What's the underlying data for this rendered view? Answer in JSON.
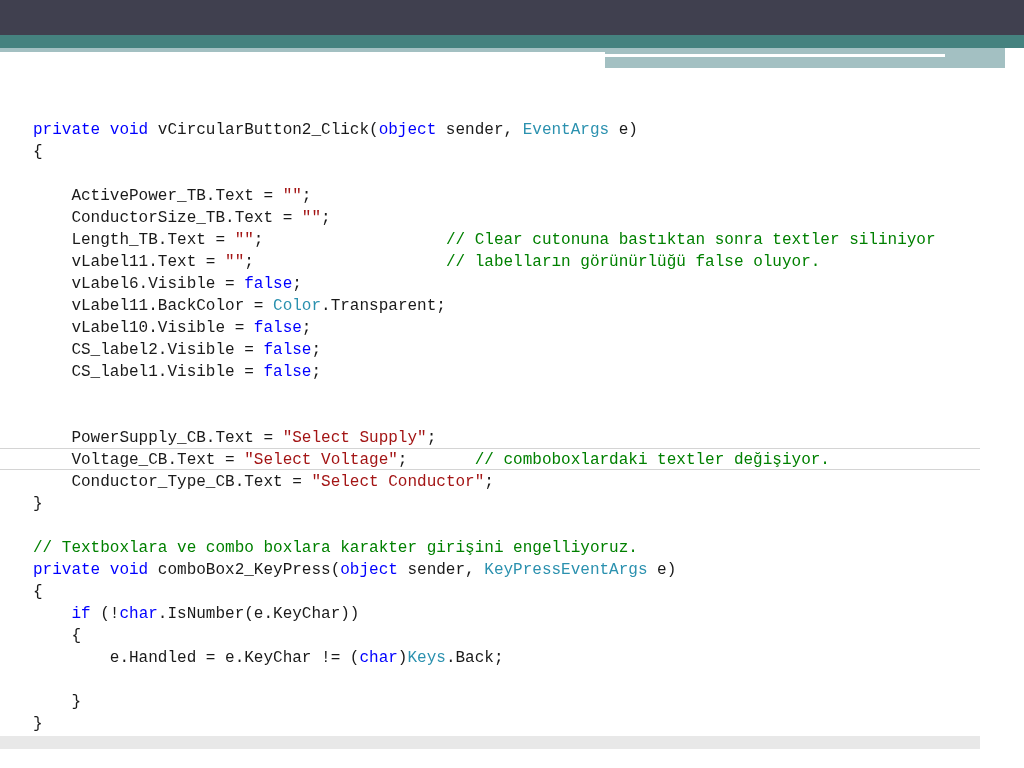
{
  "code": {
    "lines": [
      {
        "current": false,
        "tokens": [
          {
            "kind": "keyword",
            "text": "private void"
          },
          {
            "kind": "plain",
            "text": " vCircularButton2_Click("
          },
          {
            "kind": "keyword",
            "text": "object"
          },
          {
            "kind": "plain",
            "text": " sender, "
          },
          {
            "kind": "type",
            "text": "EventArgs"
          },
          {
            "kind": "plain",
            "text": " e)"
          }
        ]
      },
      {
        "current": false,
        "tokens": [
          {
            "kind": "plain",
            "text": "{"
          }
        ]
      },
      {
        "current": false
      },
      {
        "current": false,
        "tokens": [
          {
            "kind": "plain",
            "text": "    ActivePower_TB.Text = "
          },
          {
            "kind": "string",
            "text": "\"\""
          },
          {
            "kind": "plain",
            "text": ";"
          }
        ]
      },
      {
        "current": false,
        "tokens": [
          {
            "kind": "plain",
            "text": "    ConductorSize_TB.Text = "
          },
          {
            "kind": "string",
            "text": "\"\""
          },
          {
            "kind": "plain",
            "text": ";"
          }
        ]
      },
      {
        "current": false,
        "tokens": [
          {
            "kind": "plain",
            "text": "    Length_TB.Text = "
          },
          {
            "kind": "string",
            "text": "\"\""
          },
          {
            "kind": "plain",
            "text": ";                   "
          },
          {
            "kind": "comment",
            "text": "// Clear cutonuna bastıktan sonra textler siliniyor"
          }
        ]
      },
      {
        "current": false,
        "tokens": [
          {
            "kind": "plain",
            "text": "    vLabel11.Text = "
          },
          {
            "kind": "string",
            "text": "\"\""
          },
          {
            "kind": "plain",
            "text": ";                    "
          },
          {
            "kind": "comment",
            "text": "// labelların görünürlüğü false oluyor."
          }
        ]
      },
      {
        "current": false,
        "tokens": [
          {
            "kind": "plain",
            "text": "    vLabel6.Visible = "
          },
          {
            "kind": "keyword",
            "text": "false"
          },
          {
            "kind": "plain",
            "text": ";"
          }
        ]
      },
      {
        "current": false,
        "tokens": [
          {
            "kind": "plain",
            "text": "    vLabel11.BackColor = "
          },
          {
            "kind": "type",
            "text": "Color"
          },
          {
            "kind": "plain",
            "text": ".Transparent;"
          }
        ]
      },
      {
        "current": false,
        "tokens": [
          {
            "kind": "plain",
            "text": "    vLabel10.Visible = "
          },
          {
            "kind": "keyword",
            "text": "false"
          },
          {
            "kind": "plain",
            "text": ";"
          }
        ]
      },
      {
        "current": false,
        "tokens": [
          {
            "kind": "plain",
            "text": "    CS_label2.Visible = "
          },
          {
            "kind": "keyword",
            "text": "false"
          },
          {
            "kind": "plain",
            "text": ";"
          }
        ]
      },
      {
        "current": false,
        "tokens": [
          {
            "kind": "plain",
            "text": "    CS_label1.Visible = "
          },
          {
            "kind": "keyword",
            "text": "false"
          },
          {
            "kind": "plain",
            "text": ";"
          }
        ]
      },
      {
        "current": false
      },
      {
        "current": false
      },
      {
        "current": false,
        "tokens": [
          {
            "kind": "plain",
            "text": "    PowerSupply_CB.Text = "
          },
          {
            "kind": "string",
            "text": "\"Select Supply\""
          },
          {
            "kind": "plain",
            "text": ";"
          }
        ]
      },
      {
        "current": true,
        "tokens": [
          {
            "kind": "plain",
            "text": "    Voltage_CB.Text = "
          },
          {
            "kind": "string",
            "text": "\"Select Voltage\""
          },
          {
            "kind": "plain",
            "text": ";       "
          },
          {
            "kind": "comment",
            "text": "// comboboxlardaki textler değişiyor."
          }
        ]
      },
      {
        "current": false,
        "tokens": [
          {
            "kind": "plain",
            "text": "    Conductor_Type_CB.Text = "
          },
          {
            "kind": "string",
            "text": "\"Select Conductor\""
          },
          {
            "kind": "plain",
            "text": ";"
          }
        ]
      },
      {
        "current": false,
        "tokens": [
          {
            "kind": "plain",
            "text": "}"
          }
        ]
      },
      {
        "current": false
      },
      {
        "current": false,
        "tokens": [
          {
            "kind": "comment",
            "text": "// Textboxlara ve combo boxlara karakter girişini engelliyoruz."
          }
        ]
      },
      {
        "current": false,
        "tokens": [
          {
            "kind": "keyword",
            "text": "private void"
          },
          {
            "kind": "plain",
            "text": " comboBox2_KeyPress("
          },
          {
            "kind": "keyword",
            "text": "object"
          },
          {
            "kind": "plain",
            "text": " sender, "
          },
          {
            "kind": "type",
            "text": "KeyPressEventArgs"
          },
          {
            "kind": "plain",
            "text": " e)"
          }
        ]
      },
      {
        "current": false,
        "tokens": [
          {
            "kind": "plain",
            "text": "{"
          }
        ]
      },
      {
        "current": false,
        "tokens": [
          {
            "kind": "keyword",
            "text": "    if"
          },
          {
            "kind": "plain",
            "text": " (!"
          },
          {
            "kind": "keyword",
            "text": "char"
          },
          {
            "kind": "plain",
            "text": ".IsNumber(e.KeyChar))"
          }
        ]
      },
      {
        "current": false,
        "tokens": [
          {
            "kind": "plain",
            "text": "    {"
          }
        ]
      },
      {
        "current": false,
        "tokens": [
          {
            "kind": "plain",
            "text": "        e.Handled = e.KeyChar != ("
          },
          {
            "kind": "keyword",
            "text": "char"
          },
          {
            "kind": "plain",
            "text": ")"
          },
          {
            "kind": "type",
            "text": "Keys"
          },
          {
            "kind": "plain",
            "text": ".Back;"
          }
        ]
      },
      {
        "current": false
      },
      {
        "current": false,
        "tokens": [
          {
            "kind": "plain",
            "text": "    }"
          }
        ]
      },
      {
        "current": false,
        "tokens": [
          {
            "kind": "plain",
            "text": "}"
          }
        ]
      }
    ]
  }
}
